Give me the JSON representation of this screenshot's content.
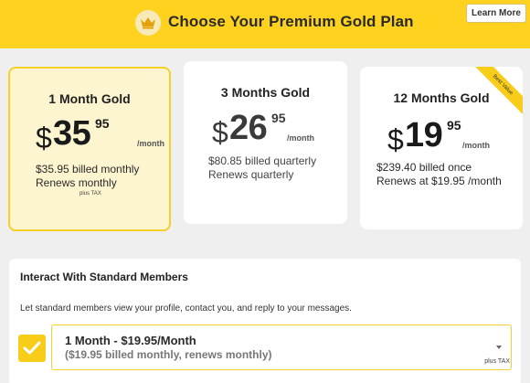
{
  "header": {
    "title": "Choose Your Premium Gold Plan",
    "learn_more_label": "Learn More",
    "icon": "crown-icon",
    "background": "#fed21e"
  },
  "plans": [
    {
      "title": "1 Month Gold",
      "currency": "$",
      "dollars": "35",
      "cents": "95",
      "per": "/month",
      "billing_line1": "$35.95 billed monthly",
      "billing_line2": "Renews monthly",
      "tax_note": "plus TAX",
      "selected": true
    },
    {
      "title": "3 Months Gold",
      "currency": "$",
      "dollars": "26",
      "cents": "95",
      "per": "/month",
      "billing_line1": "$80.85 billed quarterly",
      "billing_line2": "Renews quarterly"
    },
    {
      "title": "12 Months Gold",
      "currency": "$",
      "dollars": "19",
      "cents": "95",
      "per": "/month",
      "billing_line1": "$239.40 billed once",
      "billing_line2": "Renews at $19.95 /month",
      "ribbon": "Best Value"
    }
  ],
  "standard": {
    "title": "Interact With Standard Members",
    "description": "Let standard members view your profile, contact you, and reply to your messages.",
    "checked": true,
    "selected_option": {
      "main": "1 Month - $19.95/Month",
      "sub": "($19.95 billed monthly, renews monthly)"
    },
    "tax_note": "plus TAX"
  },
  "colors": {
    "accent": "#fed21e",
    "selected_card_bg": "#fdf5cf",
    "selected_border": "#f5cf2a",
    "page_bg": "#efefef"
  }
}
